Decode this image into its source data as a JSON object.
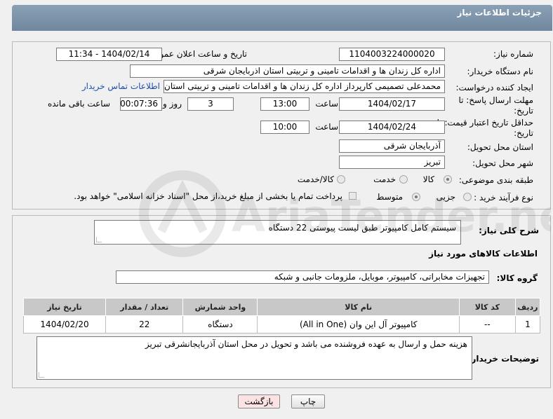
{
  "header": {
    "title": "جزئیات اطلاعات نیاز"
  },
  "form": {
    "need_number_label": "شماره نیاز:",
    "need_number": "1104003224000020",
    "announce_label": "تاریخ و ساعت اعلان عمومی:",
    "announce_value": "1404/02/14 - 11:34",
    "buyer_org_label": "نام دستگاه خریدار:",
    "buyer_org": "اداره کل زندان ها و اقدامات تامینی و تربیتی استان اذربایجان شرقی",
    "creator_label": "ایجاد کننده درخواست:",
    "creator": "محمدعلی تصمیمی کارپرداز اداره کل زندان ها و اقدامات تامینی و تربیتی استان",
    "contact_link": "اطلاعات تماس خریدار",
    "reply_deadline_label": "مهلت ارسال پاسخ: تا تاریخ:",
    "reply_date": "1404/02/17",
    "time_label": "ساعت",
    "reply_time": "13:00",
    "days": "3",
    "days_label": "روز و",
    "remaining_time": "00:07:36",
    "remaining_label": "ساعت باقی مانده",
    "price_validity_label": "حداقل تاریخ اعتبار قیمت: تا تاریخ:",
    "price_date": "1404/02/24",
    "price_time": "10:00",
    "province_label": "استان محل تحویل:",
    "province": "آذربایجان شرقی",
    "city_label": "شهر محل تحویل:",
    "city": "تبریز",
    "category_label": "طبقه بندی موضوعی:",
    "category_options": [
      "کالا",
      "خدمت",
      "کالا/خدمت"
    ],
    "process_label": "نوع فرآیند خرید :",
    "process_options": [
      "جزیی",
      "متوسط"
    ],
    "payment_note": "پرداخت تمام یا بخشی از مبلغ خرید،از محل \"اسناد خزانه اسلامی\" خواهد بود."
  },
  "details": {
    "description_label": "شرح کلی نیاز:",
    "description": "سیستم کامل کامپیوتر طبق لیست پیوستی  22 دستگاه",
    "goods_info_title": "اطلاعات کالاهای مورد نیاز",
    "goods_group_label": "گروه کالا:",
    "goods_group": "تجهیزات مخابراتی، کامپیوتر، موبایل، ملزومات جانبی و شبکه",
    "table_headers": [
      "ردیف",
      "کد کالا",
      "نام کالا",
      "واحد شمارش",
      "تعداد / مقدار",
      "تاریخ نیاز"
    ],
    "rows": [
      [
        "1",
        "--",
        "کامپیوتر آل این وان (All in One)",
        "دستگاه",
        "22",
        "1404/02/20"
      ]
    ],
    "buyer_notes_label": "توضیحات خریدار:",
    "buyer_notes": "هزینه حمل و ارسال به عهده فروشنده می باشد و تحویل در محل استان آذربایجانشرقی تبریز"
  },
  "buttons": {
    "print": "چاپ",
    "back": "بازگشت"
  },
  "watermark": "AriaTender.net"
}
